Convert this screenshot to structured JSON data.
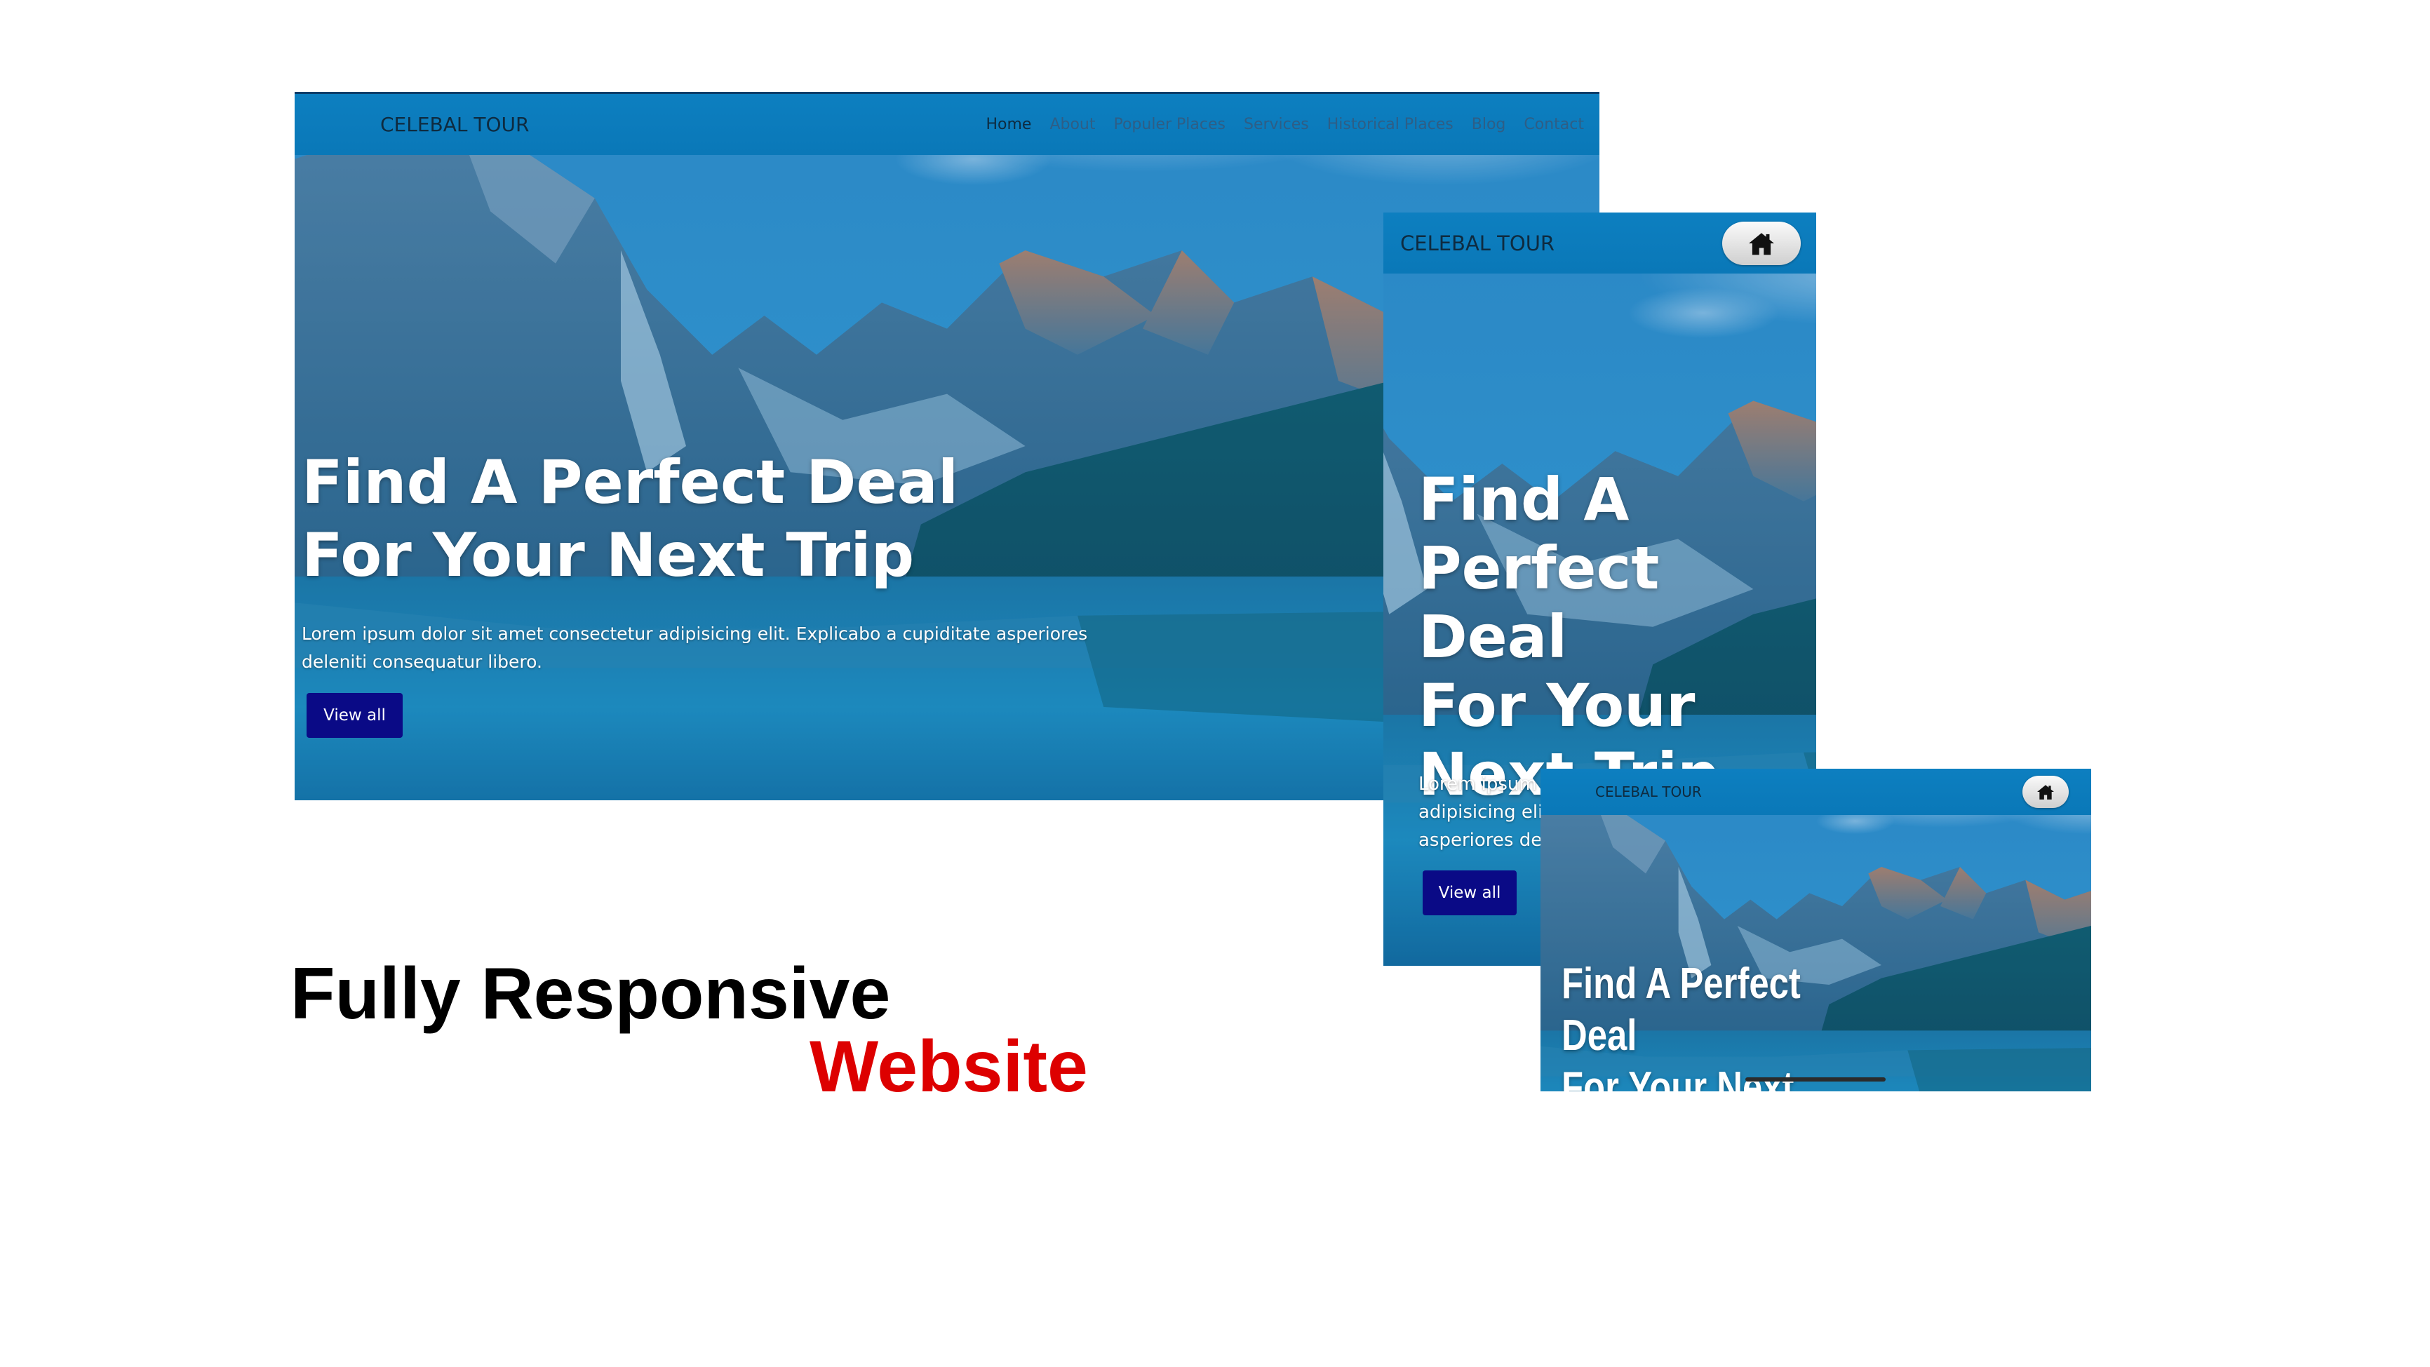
{
  "brand": "CELEBAL TOUR",
  "nav_links": [
    "Home",
    "About",
    "Populer Places",
    "Services",
    "Historical Places",
    "Blog",
    "Contact"
  ],
  "hero": {
    "title_line1": "Find A Perfect Deal",
    "title_line2": "For Your Next Trip",
    "text_line1": "Lorem ipsum dolor sit amet consectetur adipisicing elit. Explicabo a cupiditate asperiores",
    "text_line2": "deleniti consequatur libero.",
    "button": "View all"
  },
  "tablet": {
    "title_lines": [
      "Find A",
      "Perfect Deal",
      "For Your",
      "Next Trip"
    ],
    "text_lines": [
      "Lorem ipsum d",
      "adipisicing elit.",
      "asperiores dele"
    ]
  },
  "mobile": {
    "title_lines": [
      "Find A Perfect",
      "Deal",
      "For Your Next"
    ]
  },
  "caption": {
    "line1": "Fully Responsive",
    "line2": "Website"
  },
  "colors": {
    "nav": "#0b7bbb",
    "button": "#0a0a86",
    "caption_black": "#000000",
    "caption_red": "#dd0000"
  },
  "icons": [
    "home-icon"
  ]
}
